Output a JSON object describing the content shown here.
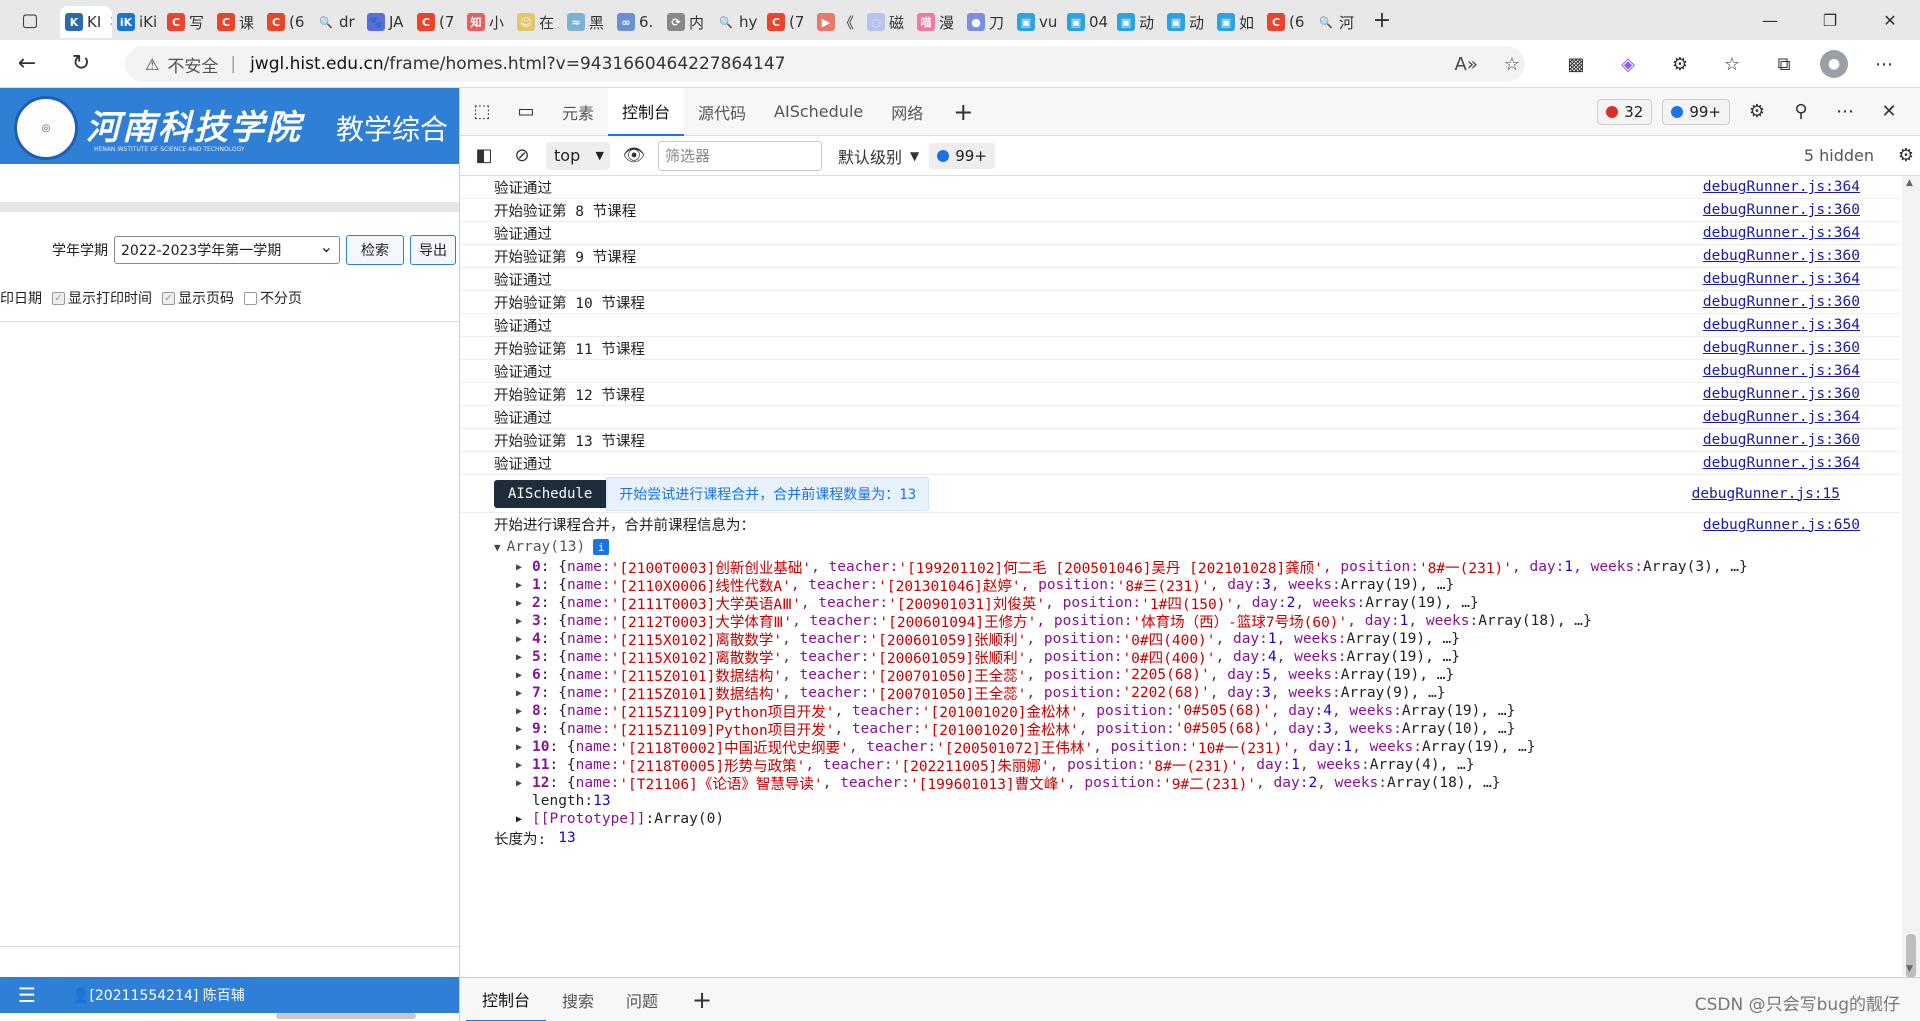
{
  "browser": {
    "tabs": [
      {
        "label": "KI",
        "favicon": "K",
        "color": "#2b6cb0",
        "active": true
      },
      {
        "label": "iKi",
        "favicon": "iK",
        "color": "#1976d2"
      },
      {
        "label": "写",
        "favicon": "C",
        "color": "#e8452c"
      },
      {
        "label": "课",
        "favicon": "C",
        "color": "#e8452c"
      },
      {
        "label": "(6",
        "favicon": "C",
        "color": "#e8452c"
      },
      {
        "label": "dr",
        "favicon": "🔍",
        "color": "#e8e8e8"
      },
      {
        "label": "JA",
        "favicon": "🐾",
        "color": "#5b6ed8"
      },
      {
        "label": "(7",
        "favicon": "C",
        "color": "#e8452c"
      },
      {
        "label": "小",
        "favicon": "知",
        "color": "#e66060"
      },
      {
        "label": "在",
        "favicon": "☺",
        "color": "#e4c66a"
      },
      {
        "label": "黑",
        "favicon": "≈",
        "color": "#7fb0d6"
      },
      {
        "label": "6.",
        "favicon": "∞",
        "color": "#6a8fd6"
      },
      {
        "label": "内",
        "favicon": "⟳",
        "color": "#888888"
      },
      {
        "label": "hy",
        "favicon": "🔍",
        "color": "#e8e8e8"
      },
      {
        "label": "(7",
        "favicon": "C",
        "color": "#e8452c"
      },
      {
        "label": "《",
        "favicon": "▶",
        "color": "#e77b6b"
      },
      {
        "label": "磁",
        "favicon": "◌",
        "color": "#b8c2ee"
      },
      {
        "label": "漫",
        "favicon": "喵",
        "color": "#f07aa0"
      },
      {
        "label": "刀",
        "favicon": "●",
        "color": "#7a8fe0"
      },
      {
        "label": "vu",
        "favicon": "▣",
        "color": "#2ba3e0"
      },
      {
        "label": "04",
        "favicon": "▣",
        "color": "#2ba3e0"
      },
      {
        "label": "动",
        "favicon": "▣",
        "color": "#2ba3e0"
      },
      {
        "label": "动",
        "favicon": "▣",
        "color": "#2ba3e0"
      },
      {
        "label": "如",
        "favicon": "▣",
        "color": "#2ba3e0"
      },
      {
        "label": "(6",
        "favicon": "C",
        "color": "#e8452c"
      },
      {
        "label": "河",
        "favicon": "🔍",
        "color": "#e8e8e8"
      }
    ],
    "address": {
      "insecure_label": "不安全",
      "host": "jwgl.hist.edu.cn",
      "path": "/frame/homes.html?v=9431660464227864147"
    }
  },
  "webpage": {
    "school_name": "河南科技学院",
    "school_name_en": "HENAN INSTITUTE OF SCIENCE AND TECHNOLOGY",
    "system_title": "教学综合",
    "term_label": "学年学期",
    "term_value": "2022-2023学年第一学期",
    "search_button": "检索",
    "export_button": "导出",
    "options": [
      {
        "label": "印日期",
        "checked": null
      },
      {
        "label": "显示打印时间",
        "checked": true
      },
      {
        "label": "显示页码",
        "checked": true
      },
      {
        "label": "不分页",
        "checked": false
      }
    ],
    "footer_user": "[20211554214] 陈百辅"
  },
  "devtools": {
    "tabs": [
      "元素",
      "控制台",
      "源代码",
      "AISchedule",
      "网络"
    ],
    "active_tab": "控制台",
    "error_count": "32",
    "message_count": "99+",
    "context": "top",
    "filter_placeholder": "筛选器",
    "level": "默认级别",
    "console_badge": "99+",
    "hidden": "5 hidden",
    "drawer_tabs": [
      "控制台",
      "搜索",
      "问题"
    ],
    "logs": [
      {
        "text": "验证通过",
        "src": "debugRunner.js:364"
      },
      {
        "text": "开始验证第 8 节课程",
        "src": "debugRunner.js:360"
      },
      {
        "text": "验证通过",
        "src": "debugRunner.js:364"
      },
      {
        "text": "开始验证第 9 节课程",
        "src": "debugRunner.js:360"
      },
      {
        "text": "验证通过",
        "src": "debugRunner.js:364"
      },
      {
        "text": "开始验证第 10 节课程",
        "src": "debugRunner.js:360"
      },
      {
        "text": "验证通过",
        "src": "debugRunner.js:364"
      },
      {
        "text": "开始验证第 11 节课程",
        "src": "debugRunner.js:360"
      },
      {
        "text": "验证通过",
        "src": "debugRunner.js:364"
      },
      {
        "text": "开始验证第 12 节课程",
        "src": "debugRunner.js:360"
      },
      {
        "text": "验证通过",
        "src": "debugRunner.js:364"
      },
      {
        "text": "开始验证第 13 节课程",
        "src": "debugRunner.js:360"
      },
      {
        "text": "验证通过",
        "src": "debugRunner.js:364"
      }
    ],
    "aischedule_log": {
      "label": "AISchedule",
      "message": "开始尝试进行课程合并，合并前课程数量为：13",
      "src": "debugRunner.js:15"
    },
    "merge_log": {
      "text": "开始进行课程合并，合并前课程信息为：",
      "src": "debugRunner.js:650"
    },
    "array_header": "Array(13)",
    "array_items": [
      {
        "idx": "0",
        "name": "'[2100T0003]创新创业基础'",
        "teacher": "'[199201102]何二毛 [200501046]吴丹 [202101028]龚颀'",
        "position": "'8#一(231)'",
        "day": "1",
        "weeks": "Array(3)"
      },
      {
        "idx": "1",
        "name": "'[2110X0006]线性代数A'",
        "teacher": "'[201301046]赵婷'",
        "position": "'8#三(231)'",
        "day": "3",
        "weeks": "Array(19)"
      },
      {
        "idx": "2",
        "name": "'[2111T0003]大学英语AⅢ'",
        "teacher": "'[200901031]刘俊英'",
        "position": "'1#四(150)'",
        "day": "2",
        "weeks": "Array(19)"
      },
      {
        "idx": "3",
        "name": "'[2112T0003]大学体育Ⅲ'",
        "teacher": "'[200601094]王修方'",
        "position": "'体育场（西）-篮球7号场(60)'",
        "day": "1",
        "weeks": "Array(18)"
      },
      {
        "idx": "4",
        "name": "'[2115X0102]离散数学'",
        "teacher": "'[200601059]张顺利'",
        "position": "'0#四(400)'",
        "day": "1",
        "weeks": "Array(19)"
      },
      {
        "idx": "5",
        "name": "'[2115X0102]离散数学'",
        "teacher": "'[200601059]张顺利'",
        "position": "'0#四(400)'",
        "day": "4",
        "weeks": "Array(19)"
      },
      {
        "idx": "6",
        "name": "'[2115Z0101]数据结构'",
        "teacher": "'[200701050]王全蕊'",
        "position": "'2205(68)'",
        "day": "5",
        "weeks": "Array(19)"
      },
      {
        "idx": "7",
        "name": "'[2115Z0101]数据结构'",
        "teacher": "'[200701050]王全蕊'",
        "position": "'2202(68)'",
        "day": "3",
        "weeks": "Array(9)"
      },
      {
        "idx": "8",
        "name": "'[2115Z1109]Python项目开发'",
        "teacher": "'[201001020]金松林'",
        "position": "'0#505(68)'",
        "day": "4",
        "weeks": "Array(19)"
      },
      {
        "idx": "9",
        "name": "'[2115Z1109]Python项目开发'",
        "teacher": "'[201001020]金松林'",
        "position": "'0#505(68)'",
        "day": "3",
        "weeks": "Array(10)"
      },
      {
        "idx": "10",
        "name": "'[2118T0002]中国近现代史纲要'",
        "teacher": "'[200501072]王伟林'",
        "position": "'10#一(231)'",
        "day": "1",
        "weeks": "Array(19)"
      },
      {
        "idx": "11",
        "name": "'[2118T0005]形势与政策'",
        "teacher": "'[202211005]朱丽娜'",
        "position": "'8#一(231)'",
        "day": "1",
        "weeks": "Array(4)"
      },
      {
        "idx": "12",
        "name": "'[T21106]《论语》智慧导读'",
        "teacher": "'[199601013]曹文峰'",
        "position": "'9#二(231)'",
        "day": "2",
        "weeks": "Array(18)"
      }
    ],
    "length_label": "length",
    "length_value": "13",
    "prototype_label": "[[Prototype]]",
    "prototype_value": "Array(0)",
    "final_label": "长度为:",
    "final_value": "13"
  },
  "watermark": "CSDN @只会写bug的靓仔"
}
